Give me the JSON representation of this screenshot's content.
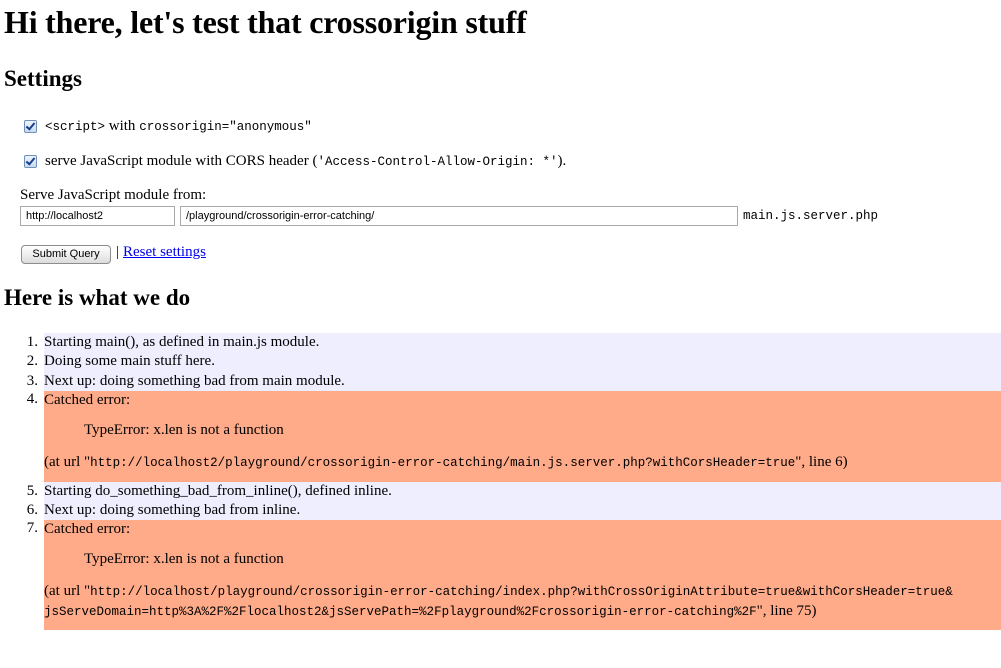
{
  "title": "Hi there, let's test that crossorigin stuff",
  "settings": {
    "heading": "Settings",
    "option1": {
      "code1": "<script>",
      "text": " with ",
      "code2": "crossorigin=\"anonymous\""
    },
    "option2": {
      "text": "serve JavaScript module with CORS header (",
      "code": "'Access-Control-Allow-Origin: *'",
      "end": ")."
    },
    "serve_from_label": "Serve JavaScript module from:",
    "domain_value": "http://localhost2",
    "path_value": "/playground/crossorigin-error-catching/",
    "script_file": "main.js.server.php",
    "submit_label": "Submit Query",
    "separator": "|",
    "reset_label": "Reset settings"
  },
  "log": {
    "heading": "Here is what we do",
    "items": [
      {
        "num": "1.",
        "text": "Starting main(), as defined in main.js module."
      },
      {
        "num": "2.",
        "text": "Doing some main stuff here."
      },
      {
        "num": "3.",
        "text": "Next up: doing something bad from main module."
      },
      {
        "num": "4.",
        "label": "Catched error:",
        "message": "TypeError: x.len is not a function",
        "url_prefix": "(at url \"",
        "url": "http://localhost2/playground/crossorigin-error-catching/main.js.server.php?withCorsHeader=true",
        "url_suffix": "\", line 6)"
      },
      {
        "num": "5.",
        "text": "Starting do_something_bad_from_inline(), defined inline."
      },
      {
        "num": "6.",
        "text": "Next up: doing something bad from inline."
      },
      {
        "num": "7.",
        "label": "Catched error:",
        "message": "TypeError: x.len is not a function",
        "url_prefix": "(at url \"",
        "url_line1": "http://localhost/playground/crossorigin-error-catching/index.php?withCrossOriginAttribute=true&withCorsHeader=true&",
        "url_line2": "jsServeDomain=http%3A%2F%2Flocalhost2&jsServePath=%2Fplayground%2Fcrossorigin-error-catching%2F",
        "url_suffix": "\", line 75)"
      }
    ]
  },
  "colors": {
    "info_bg": "#eeeeff",
    "error_bg": "#ffaa88",
    "link": "#0000ee"
  }
}
